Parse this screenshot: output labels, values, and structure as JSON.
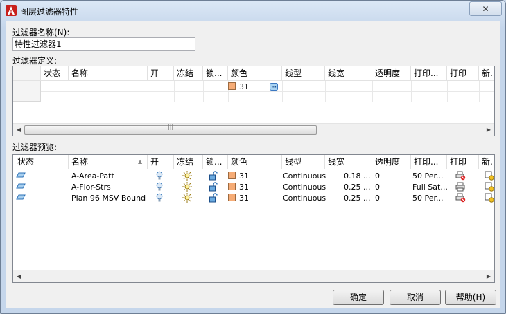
{
  "window": {
    "title": "图层过滤器特性",
    "close_label": "✕"
  },
  "filter_name": {
    "label": "过滤器名称(N):",
    "value": "特性过滤器1"
  },
  "definition": {
    "label": "过滤器定义:",
    "columns": [
      "状态",
      "名称",
      "开",
      "冻结",
      "锁...",
      "颜色",
      "线型",
      "线宽",
      "透明度",
      "打印...",
      "打印",
      "新..."
    ],
    "row": {
      "color": "31"
    }
  },
  "preview": {
    "label": "过滤器预览:",
    "columns": [
      "状态",
      "名称",
      "开",
      "冻结",
      "锁...",
      "颜色",
      "线型",
      "线宽",
      "透明度",
      "打印...",
      "打印",
      "新..."
    ],
    "rows": [
      {
        "name": "A-Area-Patt",
        "color": "31",
        "linetype": "Continuous",
        "lineweight": "0.18 ...",
        "transparency": "0",
        "plot_style": "50 Per..."
      },
      {
        "name": "A-Flor-Strs",
        "color": "31",
        "linetype": "Continuous",
        "lineweight": "0.25 ...",
        "transparency": "0",
        "plot_style": "Full Sat..."
      },
      {
        "name": "Plan 96 MSV Bound...",
        "color": "31",
        "linetype": "Continuous",
        "lineweight": "0.25 ...",
        "transparency": "0",
        "plot_style": "50 Per..."
      }
    ]
  },
  "buttons": {
    "ok": "确定",
    "cancel": "取消",
    "help": "帮助(H)"
  },
  "colors": {
    "swatch": "#f6ac76",
    "accent": "#3b78c2"
  }
}
